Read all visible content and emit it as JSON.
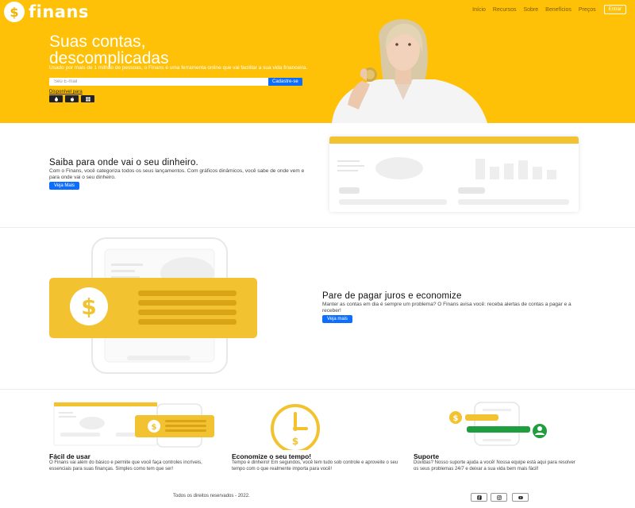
{
  "brand": {
    "name": "finans",
    "symbol": "$"
  },
  "nav": {
    "items": [
      "Início",
      "Recursos",
      "Sobre",
      "Benefícios",
      "Preços"
    ],
    "enter_label": "Entrar"
  },
  "hero": {
    "title_line1": "Suas contas,",
    "title_line2": "descomplicadas",
    "subtitle": "Usado por mais de 1 milhão de pessoas, o Finans é uma ferramenta online que vai facilitar a sua vida financeira.",
    "email_placeholder": "Seu E-mail",
    "signup_label": "Cadastre-se",
    "available_label": "Disponível para",
    "platforms": [
      "linux-icon",
      "apple-icon",
      "windows-icon"
    ]
  },
  "section_money": {
    "title": "Saiba para onde vai o seu dinheiro.",
    "text": "Com o Finans, você categoriza todos os seus lançamentos. Com gráficos dinâmicos, você sabe de onde vem e para onde vai o seu dinheiro.",
    "button": "Veja Mais"
  },
  "section_interest": {
    "title": "Pare de pagar juros e economize",
    "text": "Manter as contas em dia é sempre um problema? O Finans avisa você: receba alertas de contas a pagar e a receber!",
    "button": "Veja mais"
  },
  "features": [
    {
      "title": "Fácil de usar",
      "text": "O Finans vai além do básico e permite que você faça controles incríveis, essenciais para suas finanças. Simples como tem que ser!"
    },
    {
      "title": "Economize o seu tempo!",
      "text": "Tempo é dinheiro! Em segundos, você tem tudo sob controle e aproveite o seu tempo com o que realmente importa para você!"
    },
    {
      "title": "Suporte",
      "text": "Dúvidas? Nosso suporte ajuda a você! Nossa equipe está aqui para resolver os seus problemas 24/7 e deixar a sua vida bem mais fácil!"
    }
  ],
  "footer": {
    "copyright": "Todos os direitos reservados - 2022.",
    "social": [
      "facebook-icon",
      "instagram-icon",
      "youtube-icon"
    ]
  },
  "colors": {
    "accent": "#ffc107",
    "button": "#0d6efd",
    "illustration_yellow": "#f2c230",
    "illustration_green": "#1e9e3e"
  }
}
